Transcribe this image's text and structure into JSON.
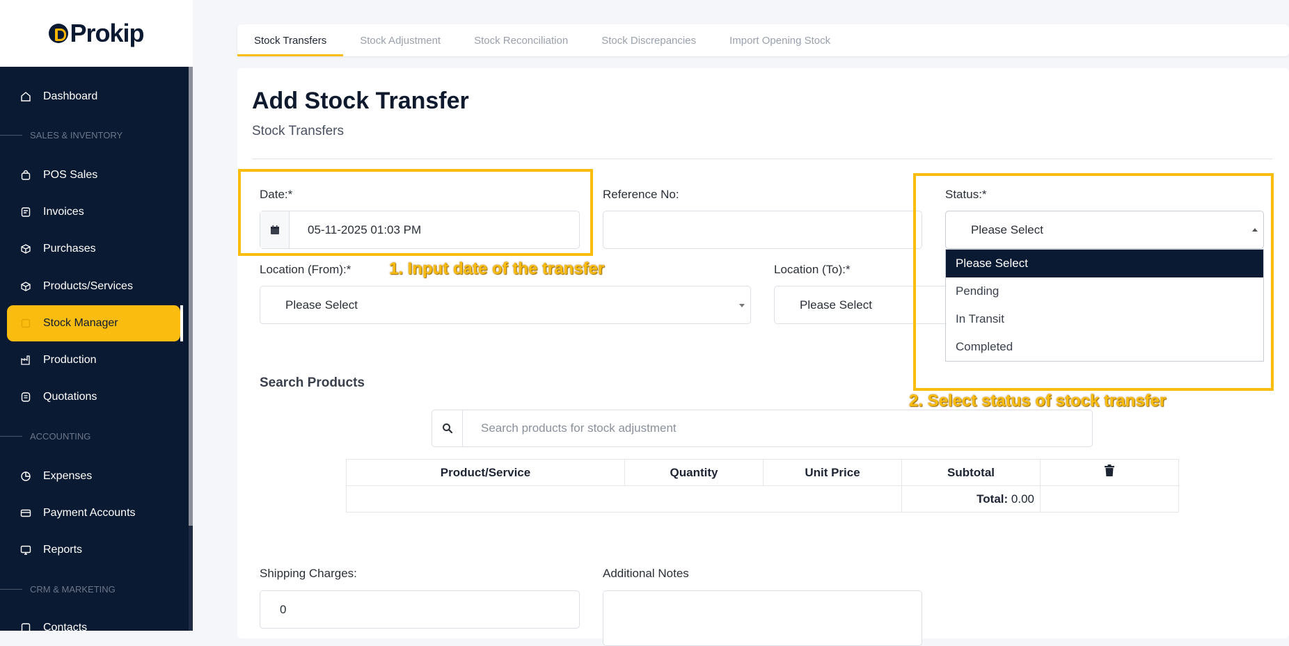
{
  "brand": {
    "logo_text": "Prokip"
  },
  "sidebar": {
    "items": [
      {
        "label": "Dashboard",
        "icon": "home-icon"
      },
      {
        "label": "POS Sales",
        "icon": "shopping-bag-icon"
      },
      {
        "label": "Invoices",
        "icon": "invoice-icon"
      },
      {
        "label": "Purchases",
        "icon": "purchase-box-icon"
      },
      {
        "label": "Products/Services",
        "icon": "cube-icon"
      },
      {
        "label": "Stock Manager",
        "icon": "folder-icon",
        "active": true
      },
      {
        "label": "Production",
        "icon": "factory-icon"
      },
      {
        "label": "Quotations",
        "icon": "quote-icon"
      },
      {
        "label": "Expenses",
        "icon": "pie-chart-icon"
      },
      {
        "label": "Payment Accounts",
        "icon": "credit-card-icon"
      },
      {
        "label": "Reports",
        "icon": "monitor-icon"
      },
      {
        "label": "Contacts",
        "icon": "contacts-icon"
      }
    ],
    "sections": [
      "SALES & INVENTORY",
      "ACCOUNTING",
      "CRM & MARKETING"
    ]
  },
  "tabs": [
    "Stock Transfers",
    "Stock Adjustment",
    "Stock Reconciliation",
    "Stock Discrepancies",
    "Import Opening Stock"
  ],
  "page": {
    "title": "Add Stock Transfer",
    "subtitle": "Stock Transfers"
  },
  "form": {
    "date_label": "Date:*",
    "date_value": "05-11-2025 01:03 PM",
    "reference_label": "Reference No:",
    "reference_value": "",
    "status_label": "Status:*",
    "status_value": "Please Select",
    "status_options": [
      "Please Select",
      "Pending",
      "In Transit",
      "Completed"
    ],
    "location_from_label": "Location (From):*",
    "location_from_value": "Please Select",
    "location_to_label": "Location (To):*",
    "location_to_value": "Please Select",
    "search_title": "Search Products",
    "search_placeholder": "Search products for stock adjustment",
    "shipping_label": "Shipping Charges:",
    "shipping_value": "0",
    "notes_label": "Additional Notes"
  },
  "table": {
    "headers": [
      "Product/Service",
      "Quantity",
      "Unit Price",
      "Subtotal"
    ],
    "total_label": "Total:",
    "total_value": "0.00"
  },
  "annotations": [
    "1. Input date of the transfer",
    "2. Select status of stock transfer"
  ],
  "colors": {
    "accent": "#fbbc10",
    "sidebar_bg": "#0b1a33"
  }
}
